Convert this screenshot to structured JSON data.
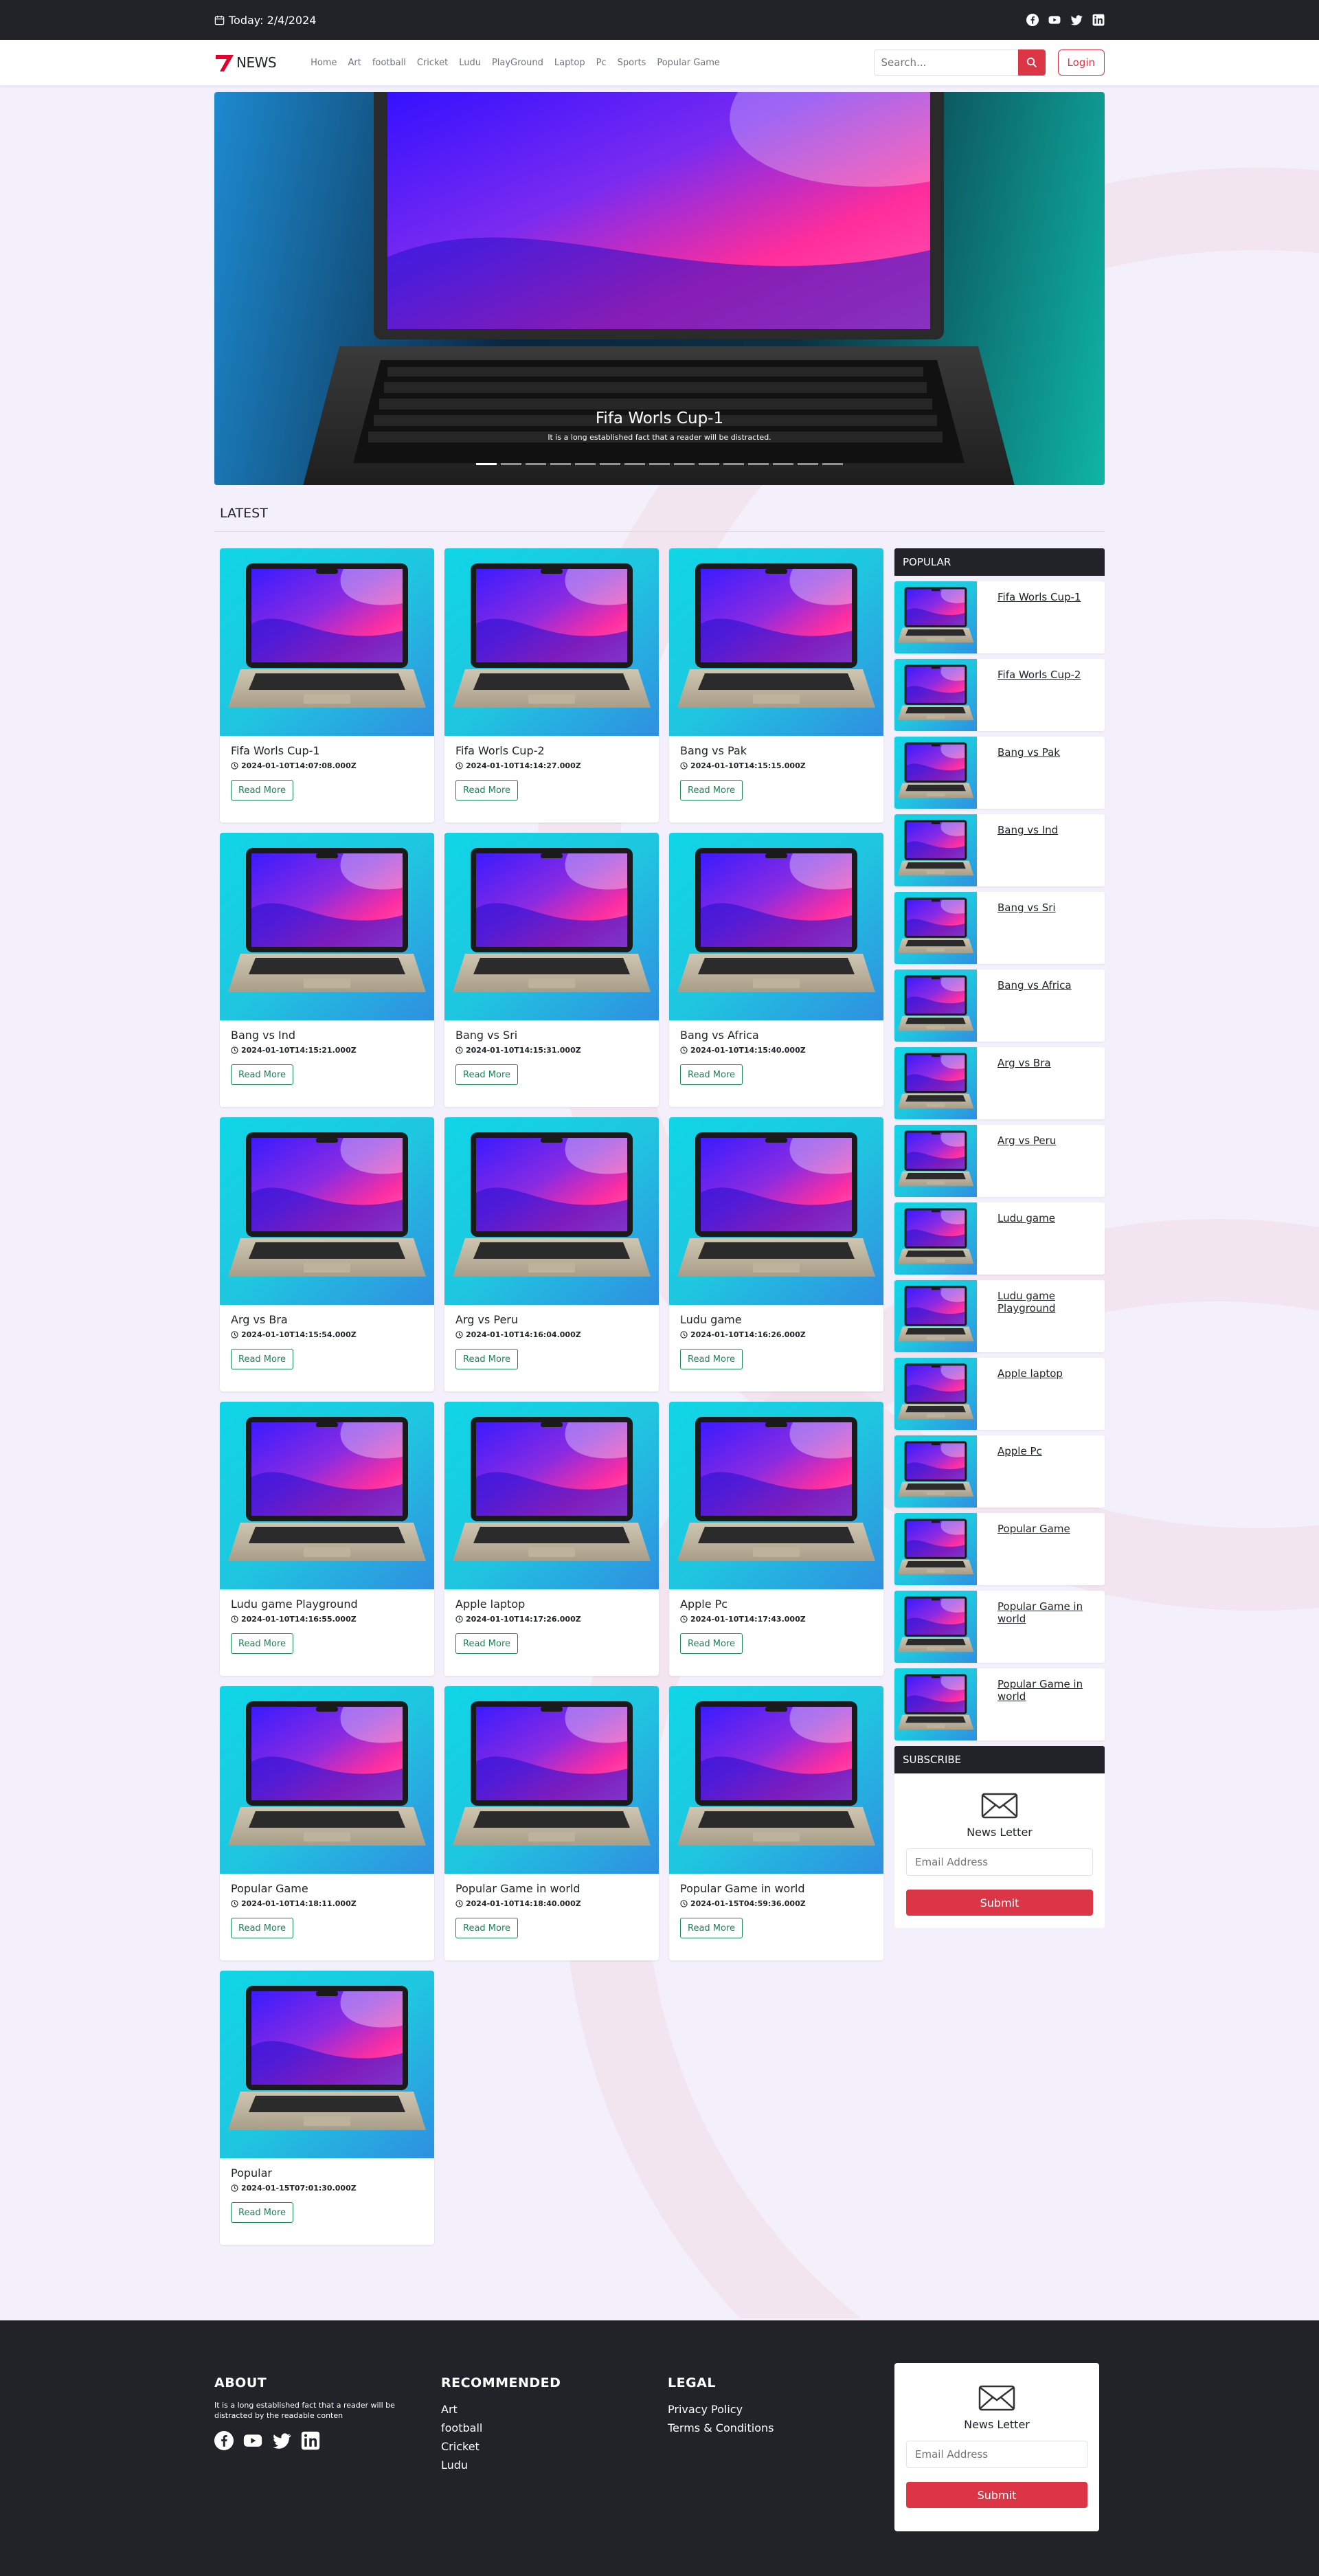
{
  "topbar": {
    "date": "Today: 2/4/2024",
    "social": [
      "facebook-icon",
      "youtube-icon",
      "twitter-icon",
      "linkedin-icon"
    ]
  },
  "navbar": {
    "brand": "NEWS",
    "menu": [
      "Home",
      "Art",
      "football",
      "Cricket",
      "Ludu",
      "PlayGround",
      "Laptop",
      "Pc",
      "Sports",
      "Popular Game"
    ],
    "search_placeholder": "Search...",
    "login_label": "Login"
  },
  "hero": {
    "title": "Fifa Worls Cup-1",
    "subtitle": "It is a long established fact that a reader will be distracted.",
    "indicator_count": 15,
    "active_indicator": 0
  },
  "latest": {
    "heading": "LATEST",
    "read_more_label": "Read More",
    "cards": [
      {
        "title": "Fifa Worls Cup-1",
        "date": "2024-01-10T14:07:08.000Z"
      },
      {
        "title": "Fifa Worls Cup-2",
        "date": "2024-01-10T14:14:27.000Z"
      },
      {
        "title": "Bang vs Pak",
        "date": "2024-01-10T14:15:15.000Z"
      },
      {
        "title": "Bang vs Ind",
        "date": "2024-01-10T14:15:21.000Z"
      },
      {
        "title": "Bang vs Sri",
        "date": "2024-01-10T14:15:31.000Z"
      },
      {
        "title": "Bang vs Africa",
        "date": "2024-01-10T14:15:40.000Z"
      },
      {
        "title": "Arg vs Bra",
        "date": "2024-01-10T14:15:54.000Z"
      },
      {
        "title": "Arg vs Peru",
        "date": "2024-01-10T14:16:04.000Z"
      },
      {
        "title": "Ludu game",
        "date": "2024-01-10T14:16:26.000Z"
      },
      {
        "title": "Ludu game Playground",
        "date": "2024-01-10T14:16:55.000Z"
      },
      {
        "title": "Apple laptop",
        "date": "2024-01-10T14:17:26.000Z"
      },
      {
        "title": "Apple Pc",
        "date": "2024-01-10T14:17:43.000Z"
      },
      {
        "title": "Popular Game",
        "date": "2024-01-10T14:18:11.000Z"
      },
      {
        "title": "Popular Game in world",
        "date": "2024-01-10T14:18:40.000Z"
      },
      {
        "title": "Popular Game in world",
        "date": "2024-01-15T04:59:36.000Z"
      },
      {
        "title": "Popular",
        "date": "2024-01-15T07:01:30.000Z"
      }
    ]
  },
  "popular": {
    "heading": "POPULAR",
    "items": [
      "Fifa Worls Cup-1",
      "Fifa Worls Cup-2",
      "Bang vs Pak",
      "Bang vs Ind",
      "Bang vs Sri",
      "Bang vs Africa",
      "Arg vs Bra",
      "Arg vs Peru",
      "Ludu game",
      "Ludu game Playground",
      "Apple laptop",
      "Apple Pc",
      "Popular Game",
      "Popular Game in world",
      "Popular Game in world"
    ]
  },
  "subscribe": {
    "heading": "SUBSCRIBE",
    "label": "News Letter",
    "email_placeholder": "Email Address",
    "submit_label": "Submit"
  },
  "footer": {
    "about_title": "ABOUT",
    "about_text": "It is a long established fact that a reader will be distracted by the readable conten",
    "recommended_title": "RECOMMENDED",
    "recommended": [
      "Art",
      "football",
      "Cricket",
      "Ludu"
    ],
    "legal_title": "LEGAL",
    "legal": [
      "Privacy Policy",
      "Terms & Conditions"
    ],
    "newsletter_label": "News Letter",
    "email_placeholder": "Email Address",
    "submit_label": "Submit"
  },
  "colors": {
    "dark": "#212329",
    "accent": "#dc3545",
    "success": "#198754",
    "background": "#f3f0fb"
  }
}
